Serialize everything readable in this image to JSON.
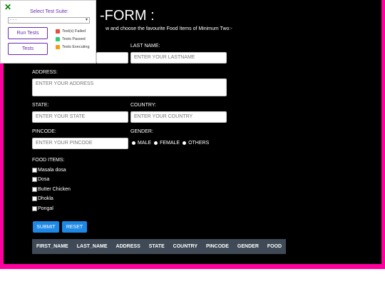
{
  "form": {
    "title": "-FORM :",
    "subtitle": "w and choose the favourite Food Items of Minimum Two:-",
    "lastname_label": "LAST NAME:",
    "lastname_placeholder": "ENTER YOUR LASTNAME",
    "address_label": "ADDRESS:",
    "address_placeholder": "ENTER YOUR ADDRESS",
    "state_label": "STATE:",
    "state_placeholder": "ENTER YOUR STATE",
    "country_label": "COUNTRY:",
    "country_placeholder": "ENTER YOUR COUNTRY",
    "pincode_label": "PINCODE:",
    "pincode_placeholder": "ENTER YOUR PINCODE",
    "gender_label": "GENDER:",
    "gender_options": [
      "MALE",
      "FEMALE",
      "OTHERS"
    ],
    "food_label": "FOOD ITEMS:",
    "food_items": [
      "Masala dosa",
      "Dosa",
      "Butter Chicken",
      "Dhokla",
      "Pongal"
    ],
    "submit_label": "SUBMIT",
    "reset_label": "RESET"
  },
  "table": {
    "headers": [
      "FIRST_NAME",
      "LAST_NAME",
      "ADDRESS",
      "STATE",
      "COUNTRY",
      "PINCODE",
      "GENDER",
      "FOOD"
    ]
  },
  "panel": {
    "close_icon": "close-icon",
    "select_label": "Select Test Suite:",
    "select_value": "- - -",
    "run_tests_label": "Run Tests",
    "tests_label": "Tests",
    "legend": [
      {
        "label": "Test(s) Failed",
        "color": "#e74c3c"
      },
      {
        "label": "Tests Passed",
        "color": "#2ecc71"
      },
      {
        "label": "Tests Executing",
        "color": "#f39c12"
      }
    ]
  },
  "colors": {
    "frame": "#ff009e",
    "accent_button": "#1e88e5",
    "panel_accent": "#6a2bb3"
  }
}
